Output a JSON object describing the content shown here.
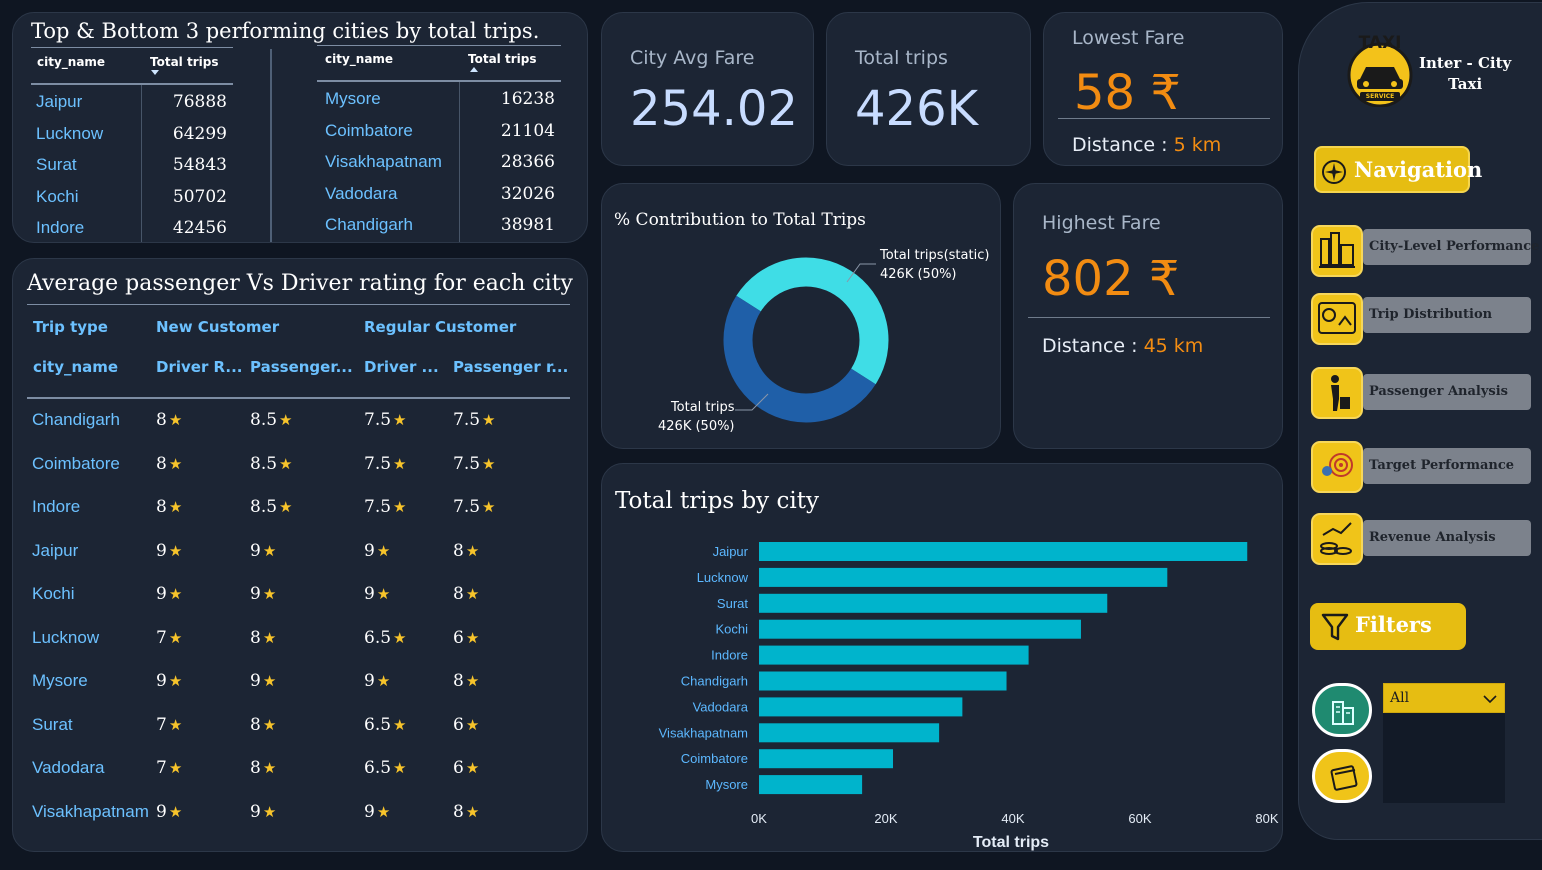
{
  "top_bottom": {
    "title": "Top & Bottom 3 performing cities by total trips.",
    "col_city": "city_name",
    "col_trips": "Total trips",
    "top": [
      {
        "city": "Jaipur",
        "trips": "76888"
      },
      {
        "city": "Lucknow",
        "trips": "64299"
      },
      {
        "city": "Surat",
        "trips": "54843"
      },
      {
        "city": "Kochi",
        "trips": "50702"
      },
      {
        "city": "Indore",
        "trips": "42456"
      }
    ],
    "bottom": [
      {
        "city": "Mysore",
        "trips": "16238"
      },
      {
        "city": "Coimbatore",
        "trips": "21104"
      },
      {
        "city": "Visakhapatnam",
        "trips": "28366"
      },
      {
        "city": "Vadodara",
        "trips": "32026"
      },
      {
        "city": "Chandigarh",
        "trips": "38981"
      }
    ]
  },
  "ratings": {
    "title": "Average passenger Vs Driver rating for each city",
    "trip_type_label": "Trip type",
    "new_customer": "New Customer",
    "regular_customer": "Regular Customer",
    "city_label": "city_name",
    "driver_new": "Driver R...",
    "passenger_new": "Passenger...",
    "driver_reg": "Driver ...",
    "passenger_reg": "Passenger r...",
    "rows": [
      {
        "city": "Chandigarh",
        "v": [
          "8",
          "8.5",
          "7.5",
          "7.5"
        ]
      },
      {
        "city": "Coimbatore",
        "v": [
          "8",
          "8.5",
          "7.5",
          "7.5"
        ]
      },
      {
        "city": "Indore",
        "v": [
          "8",
          "8.5",
          "7.5",
          "7.5"
        ]
      },
      {
        "city": "Jaipur",
        "v": [
          "9",
          "9",
          "9",
          "8"
        ]
      },
      {
        "city": "Kochi",
        "v": [
          "9",
          "9",
          "9",
          "8"
        ]
      },
      {
        "city": "Lucknow",
        "v": [
          "7",
          "8",
          "6.5",
          "6"
        ]
      },
      {
        "city": "Mysore",
        "v": [
          "9",
          "9",
          "9",
          "8"
        ]
      },
      {
        "city": "Surat",
        "v": [
          "7",
          "8",
          "6.5",
          "6"
        ]
      },
      {
        "city": "Vadodara",
        "v": [
          "7",
          "8",
          "6.5",
          "6"
        ]
      },
      {
        "city": "Visakhapatnam",
        "v": [
          "9",
          "9",
          "9",
          "8"
        ]
      }
    ]
  },
  "kpis": {
    "avg_fare_label": "City Avg Fare",
    "avg_fare_value": "254.02",
    "total_trips_label": "Total trips",
    "total_trips_value": "426K",
    "lowest_label": "Lowest Fare",
    "lowest_value": "58 ₹",
    "lowest_distance_label": "Distance :",
    "lowest_distance": "5 km",
    "highest_label": "Highest Fare",
    "highest_value": "802 ₹",
    "highest_distance_label": "Distance :",
    "highest_distance": "45 km"
  },
  "donut": {
    "title": "% Contribution to Total Trips",
    "segments": [
      {
        "label": "Total trips(static)",
        "value_label": "426K (50%)",
        "share": 50,
        "color": "#3fdde6"
      },
      {
        "label": "Total trips",
        "value_label": "426K (50%)",
        "share": 50,
        "color": "#1f5fa8"
      }
    ]
  },
  "chart_data": {
    "type": "bar",
    "orientation": "horizontal",
    "title": "Total trips by city",
    "xlabel": "Total trips",
    "ylabel": "",
    "categories": [
      "Jaipur",
      "Lucknow",
      "Surat",
      "Kochi",
      "Indore",
      "Chandigarh",
      "Vadodara",
      "Visakhapatnam",
      "Coimbatore",
      "Mysore"
    ],
    "values": [
      76888,
      64299,
      54843,
      50702,
      42456,
      38981,
      32026,
      28366,
      21104,
      16238
    ],
    "xlim": [
      0,
      80000
    ],
    "xticks": [
      "0K",
      "20K",
      "40K",
      "60K",
      "80K"
    ],
    "bar_color": "#00b4cc"
  },
  "panel": {
    "logo_text": "TAXI",
    "logo_sub": "SERVICE",
    "brand_line1": "Inter - City",
    "brand_line2": "Taxi",
    "navigation_label": "Navigation",
    "pages": [
      {
        "label": "City-Level Performance",
        "icon": "city-chart-icon"
      },
      {
        "label": "Trip Distribution",
        "icon": "map-chart-icon"
      },
      {
        "label": "Passenger Analysis",
        "icon": "passenger-icon"
      },
      {
        "label": "Target Performance",
        "icon": "target-icon"
      },
      {
        "label": "Revenue Analysis",
        "icon": "revenue-icon"
      }
    ],
    "filters_label": "Filters",
    "dropdown_value": "All"
  }
}
